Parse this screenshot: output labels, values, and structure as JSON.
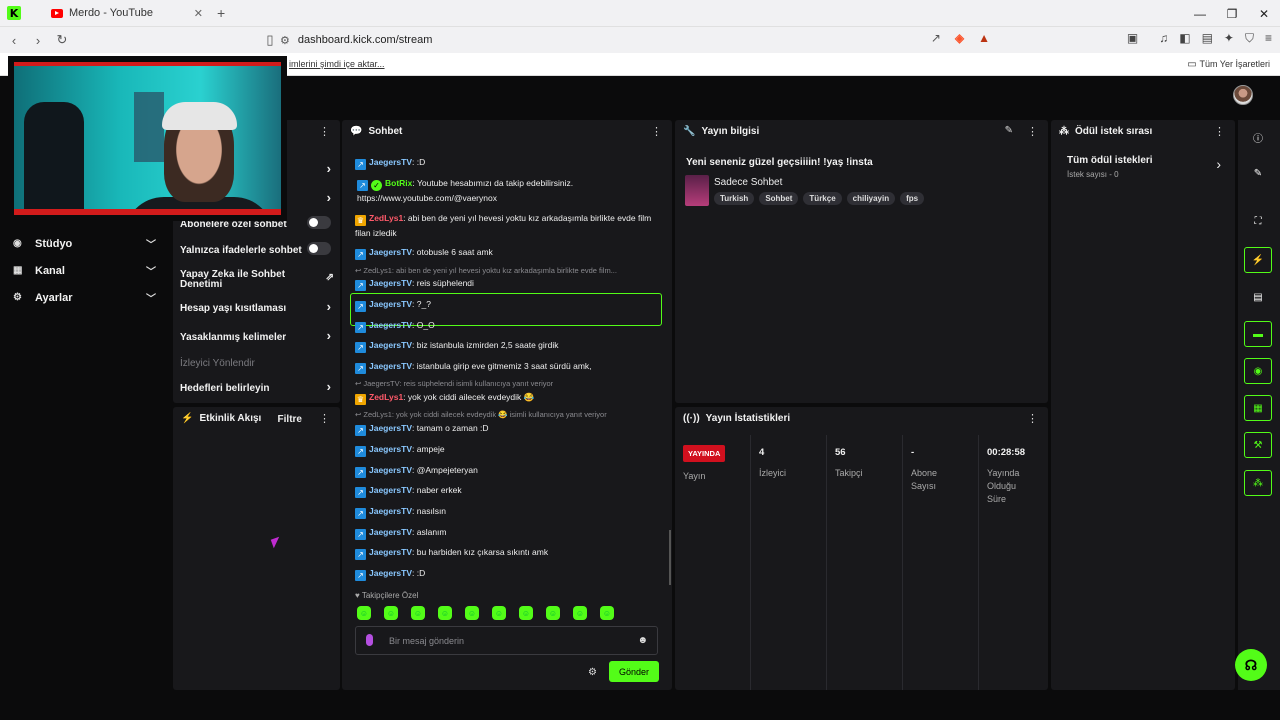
{
  "browser": {
    "tab_title": "Merdo - YouTube",
    "url": "dashboard.kick.com/stream",
    "import_text": "imlerini şimdi içe aktar...",
    "all_bookmarks": "Tüm Yer İşaretleri"
  },
  "mod_panel": {
    "items": [
      {
        "label": "Abonelere özel sohbet"
      },
      {
        "label": "Yalnızca ifadelerle sohbet"
      },
      {
        "label": "Yapay Zeka ile Sohbet Denetimi"
      },
      {
        "label": "Hesap yaşı kısıtlaması"
      },
      {
        "label": "Yasaklanmış kelimeler"
      },
      {
        "label": "İzleyici Yönlendir"
      },
      {
        "label": "Hedefleri belirleyin"
      }
    ]
  },
  "leftnav": {
    "items": [
      {
        "label": "Stüdyo"
      },
      {
        "label": "Kanal"
      },
      {
        "label": "Ayarlar"
      }
    ]
  },
  "activity": {
    "title": "Etkinlik Akışı",
    "filter": "Filtre"
  },
  "chat": {
    "title": "Sohbet",
    "messages": [
      {
        "user": "JaegersTV",
        "text": ":D"
      },
      {
        "user": "BotRix",
        "text": "Youtube hesabımızı da takip edebilirsiniz.",
        "link": "https://www.youtube.com/@vaerynox"
      },
      {
        "user": "ZedLys1",
        "text": "abi ben de yeni yıl hevesi yoktu kız arkadaşımla birlikte evde film filan izledik"
      },
      {
        "user": "JaegersTV",
        "text": "otobusle 6 saat amk"
      },
      {
        "reply": "ZedLys1: abi ben de yeni yıl hevesi yoktu kız arkadaşımla birlikte evde film..."
      },
      {
        "user": "JaegersTV",
        "text": "reis süphelendi"
      },
      {
        "user": "JaegersTV",
        "text": "?_?"
      },
      {
        "user": "JaegersTV",
        "text": "O_O"
      },
      {
        "user": "JaegersTV",
        "text": "biz istanbula izmirden 2,5 saate girdik"
      },
      {
        "user": "JaegersTV",
        "text": "istanbula girip eve gitmemiz 3 saat sürdü amk,"
      },
      {
        "reply": "JaegersTV: reis süphelendi isimli kullanıcıya yanıt veriyor"
      },
      {
        "user": "ZedLys1",
        "text": "yok yok ciddi ailecek evdeydik 😂"
      },
      {
        "reply": "ZedLys1: yok yok ciddi ailecek evdeydik 😂 isimli kullanıcıya yanıt veriyor"
      },
      {
        "user": "JaegersTV",
        "text": "tamam o zaman :D"
      },
      {
        "user": "JaegersTV",
        "text": "ampeje"
      },
      {
        "user": "JaegersTV",
        "text": "@Ampejeteryan"
      },
      {
        "user": "JaegersTV",
        "text": "naber erkek"
      },
      {
        "user": "JaegersTV",
        "text": "nasılsın"
      },
      {
        "user": "JaegersTV",
        "text": "aslanım"
      },
      {
        "user": "JaegersTV",
        "text": "bu harbiden kız çıkarsa sıkıntı amk"
      },
      {
        "user": "JaegersTV",
        "text": ":D"
      }
    ],
    "follower_label": "Takipçilere Özel",
    "input_placeholder": "Bir mesaj gönderin",
    "send_label": "Gönder"
  },
  "stream_info": {
    "title": "Yayın bilgisi",
    "stream_title": "Yeni seneniz güzel geçsiiiin! !yaş !insta",
    "category": "Sadece Sohbet",
    "tags": [
      "Turkish",
      "Sohbet",
      "Türkçe",
      "chiliyayin",
      "fps"
    ]
  },
  "stats": {
    "title": "Yayın İstatistikleri",
    "live_badge": "YAYINDA",
    "stream_label": "Yayın",
    "viewers": "4",
    "viewers_label": "İzleyici",
    "followers": "56",
    "followers_label": "Takipçi",
    "subs": "-",
    "subs_label": "Abone Sayısı",
    "uptime": "00:28:58",
    "uptime_label": "Yayında Olduğu Süre"
  },
  "rewards": {
    "title": "Ödül istek sırası",
    "all": "Tüm ödül istekleri",
    "count": "İstek sayısı - 0"
  }
}
